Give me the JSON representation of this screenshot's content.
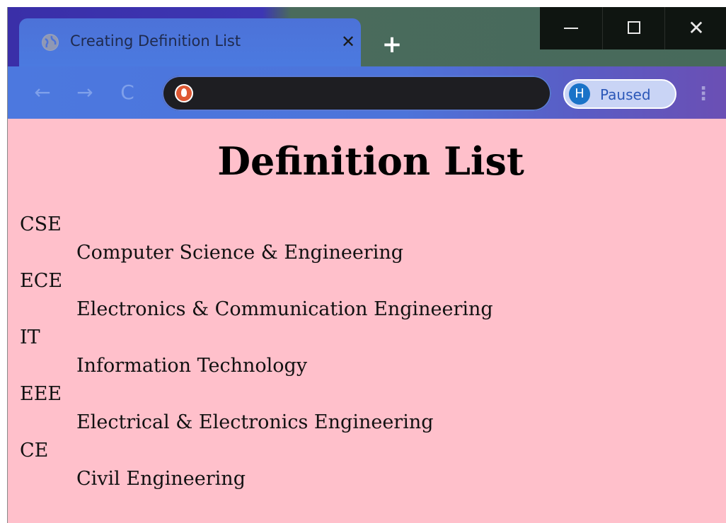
{
  "browser": {
    "tab": {
      "title": "Creating Definition List",
      "close_glyph": "✕",
      "favicon": "globe-icon"
    },
    "new_tab_glyph": "+",
    "window_controls": {
      "close_glyph": "✕"
    },
    "toolbar": {
      "back_glyph": "←",
      "forward_glyph": "→",
      "reload_glyph": "C",
      "address_icon": "duckduckgo-icon",
      "profile": {
        "initial": "H",
        "status": "Paused"
      },
      "menu_glyph": "⋮"
    },
    "colors": {
      "content_bg": "#ffc0cb",
      "avatar": "#1a73c8"
    }
  },
  "page": {
    "heading": "Definition List",
    "definitions": [
      {
        "term": "CSE",
        "description": "Computer Science & Engineering"
      },
      {
        "term": "ECE",
        "description": "Electronics & Communication Engineering"
      },
      {
        "term": "IT",
        "description": "Information Technology"
      },
      {
        "term": "EEE",
        "description": "Electrical & Electronics Engineering"
      },
      {
        "term": "CE",
        "description": "Civil Engineering"
      }
    ]
  }
}
